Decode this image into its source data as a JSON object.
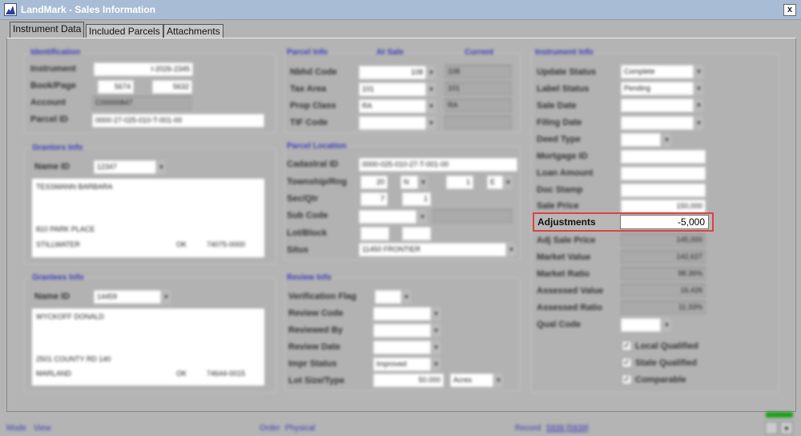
{
  "window": {
    "title": "LandMark - Sales Information",
    "close": "x"
  },
  "tabs": [
    "Instrument Data",
    "Included Parcels",
    "Attachments"
  ],
  "identification": {
    "title": "Identification",
    "instrument_label": "Instrument",
    "instrument": "I-2026-2345",
    "bookpage_label": "Book/Page",
    "book": "5674",
    "page": "5632",
    "account_label": "Account",
    "account": "C00000847",
    "parcel_label": "Parcel ID",
    "parcel": "0000-27-025-010-T-001-00"
  },
  "grantors": {
    "title": "Grantors Info",
    "name_id_label": "Name ID",
    "name_id": "12347",
    "name": "TESSMANN BARBARA",
    "address": "810 PARK PLACE",
    "city": "STILLWATER",
    "state": "OK",
    "zip": "74075-0000"
  },
  "grantees": {
    "title": "Grantees Info",
    "name_id_label": "Name ID",
    "name_id": "14459",
    "name": "WYCKOFF DONALD",
    "address": "2501 COUNTY RD 140",
    "city": "MARLAND",
    "state": "OK",
    "zip": "74644-0015"
  },
  "parcel_info": {
    "title": "Parcel Info",
    "at_sale": "At Sale",
    "current": "Current",
    "rows": [
      {
        "label": "Nbhd Code",
        "sale": "108",
        "cur": "108"
      },
      {
        "label": "Tax Area",
        "sale": "101",
        "cur": "101"
      },
      {
        "label": "Prop Class",
        "sale": "RA",
        "cur": "RA"
      },
      {
        "label": "TIF Code",
        "sale": "",
        "cur": ""
      }
    ]
  },
  "parcel_location": {
    "title": "Parcel Location",
    "cadastral_label": "Cadastral ID",
    "cadastral": "0000-025-010-27-T-001-00",
    "twp_label": "Township/Rng",
    "twp": "20",
    "twp_dir": "N",
    "rng": "1",
    "rng_dir": "E",
    "secqtr_label": "Sec/Qtr",
    "sec": "7",
    "qtr": "1",
    "subcode_label": "Sub Code",
    "lotblock_label": "Lot/Block",
    "situs_label": "Situs",
    "situs": "11450 FRONTIER"
  },
  "review": {
    "title": "Review Info",
    "verification_label": "Verification Flag",
    "review_code_label": "Review Code",
    "reviewed_by_label": "Reviewed By",
    "review_date_label": "Review Date",
    "impr_status_label": "Impr Status",
    "impr_status": "Improved",
    "lot_size_label": "Lot Size/Type",
    "lot_size": "50.000",
    "lot_type": "Acres"
  },
  "instrument_info": {
    "title": "Instrument Info",
    "update_status_label": "Update Status",
    "update_status": "Complete",
    "label_status_label": "Label Status",
    "label_status": "Pending",
    "sale_date_label": "Sale Date",
    "filing_date_label": "Filing Date",
    "deed_type_label": "Deed Type",
    "mortgage_label": "Mortgage ID",
    "loan_label": "Loan Amount",
    "doc_stamp_label": "Doc Stamp",
    "sale_price_label": "Sale Price",
    "sale_price": "150,000",
    "adjustments_label": "Adjustments",
    "adjustments": "-5,000",
    "adj_sale_label": "Adj Sale Price",
    "adj_sale": "145,000",
    "market_value_label": "Market Value",
    "market_value": "142,627",
    "market_ratio_label": "Market Ratio",
    "market_ratio": "98.36%",
    "assessed_value_label": "Assessed Value",
    "assessed_value": "16,426",
    "assessed_ratio_label": "Assessed Ratio",
    "assessed_ratio": "11.33%",
    "qual_code_label": "Qual Code",
    "local_qualified": "Local Qualified",
    "state_qualified": "State Qualified",
    "comparable": "Comparable"
  },
  "statusbar": {
    "mode_label": "Mode",
    "mode": "View",
    "order_label": "Order",
    "order": "Physical",
    "record_label": "Record",
    "record": "5939 [5939]"
  }
}
